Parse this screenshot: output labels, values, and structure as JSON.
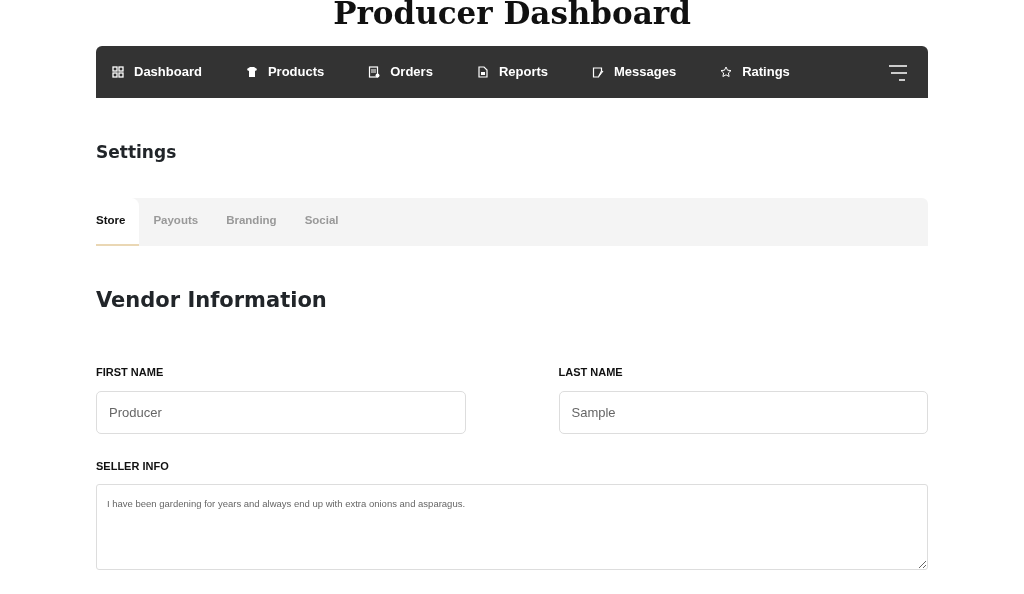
{
  "page_title": "Producer Dashboard",
  "nav": {
    "items": [
      {
        "label": "Dashboard"
      },
      {
        "label": "Products"
      },
      {
        "label": "Orders"
      },
      {
        "label": "Reports"
      },
      {
        "label": "Messages"
      },
      {
        "label": "Ratings"
      }
    ]
  },
  "section_title": "Settings",
  "tabs": [
    {
      "label": "Store",
      "selected": true
    },
    {
      "label": "Payouts",
      "selected": false
    },
    {
      "label": "Branding",
      "selected": false
    },
    {
      "label": "Social",
      "selected": false
    }
  ],
  "form": {
    "heading": "Vendor Information",
    "fields": [
      {
        "kind": "input",
        "label": "FIRST NAME",
        "value": "Producer"
      },
      {
        "kind": "input",
        "label": "LAST NAME",
        "value": "Sample"
      },
      {
        "kind": "textarea",
        "label": "SELLER INFO",
        "value": "I have been gardening for years and always end up with extra onions and asparagus."
      }
    ]
  }
}
